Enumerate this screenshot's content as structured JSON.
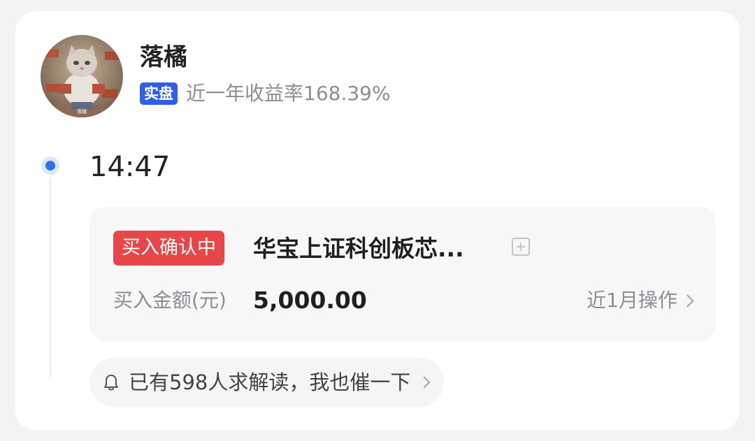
{
  "user": {
    "name": "落橘",
    "badge": "实盘",
    "return_text": "近一年收益率168.39%",
    "avatar_watermark": "落橘"
  },
  "timeline": {
    "time": "14:47"
  },
  "trade": {
    "status": "买入确认中",
    "fund_name": "华宝上证科创板芯...",
    "amount_label": "买入金额(元)",
    "amount_value": "5,000.00",
    "recent_ops_label": "近1月操作"
  },
  "reminder": {
    "text": "已有598人求解读，我也催一下"
  },
  "colors": {
    "badge": "#2f5fe6",
    "status_tag": "#e8474a",
    "timeline_dot": "#2d73f0"
  },
  "icons": [
    "avatar-image",
    "add-watchlist-icon",
    "chevron-right-icon",
    "bell-icon"
  ]
}
